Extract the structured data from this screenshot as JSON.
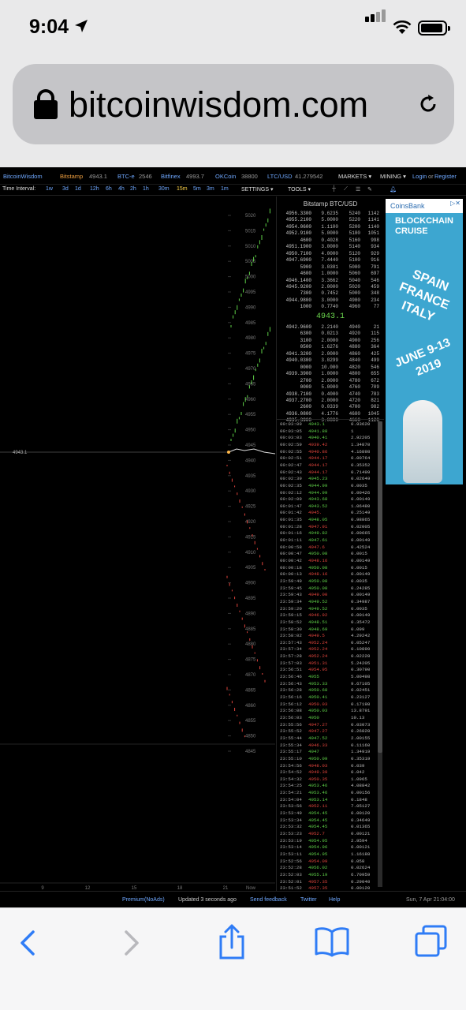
{
  "status_bar": {
    "time": "9:04"
  },
  "browser": {
    "url": "bitcoinwisdom.com"
  },
  "topnav": {
    "brand": "BitcoinWisdom",
    "exchanges": [
      {
        "name": "Bitstamp",
        "price": "4943.1"
      },
      {
        "name": "BTC-e",
        "price": "2546"
      },
      {
        "name": "Bitfinex",
        "price": "4993.7"
      },
      {
        "name": "OKCoin",
        "price": "38800"
      },
      {
        "name": "LTC/USD",
        "price": "41.279542"
      }
    ],
    "markets": "MARKETS ▾",
    "mining": "MINING ▾",
    "login": "Login",
    "or": "or",
    "register": "Register"
  },
  "toolbar": {
    "time_interval_label": "Time Interval:",
    "intervals": [
      "1w",
      "3d",
      "1d",
      "12h",
      "6h",
      "4h",
      "2h",
      "1h",
      "30m",
      "15m",
      "5m",
      "3m",
      "1m"
    ],
    "settings": "SETTINGS ▾",
    "tools": "TOOLS ▾"
  },
  "chart": {
    "price_label": "4943.1",
    "y_ticks": [
      "5020",
      "5015",
      "5010",
      "5005",
      "5000",
      "4995",
      "4990",
      "4985",
      "4980",
      "4975",
      "4970",
      "4965",
      "4960",
      "4955",
      "4950",
      "4945",
      "4940",
      "4935",
      "4930",
      "4925",
      "4920",
      "4915",
      "4910",
      "4905",
      "4900",
      "4895",
      "4890",
      "4885",
      "4880",
      "4875",
      "4870",
      "4865",
      "4860",
      "4855",
      "4850",
      "4845"
    ],
    "x_ticks": [
      "9",
      "12",
      "15",
      "18",
      "21",
      "Now"
    ]
  },
  "orderbook": {
    "title": "Bitstamp BTC/USD",
    "asks": [
      [
        "4956.3300",
        "9.6235",
        "5240",
        "1142"
      ],
      [
        "4955.2100",
        "5.0000",
        "5220",
        "1141"
      ],
      [
        "4954.0600",
        "1.1100",
        "5200",
        "1140"
      ],
      [
        "4952.9100",
        "5.0000",
        "5180",
        "1051"
      ],
      [
        "4600",
        "0.4028",
        "5160",
        "998"
      ],
      [
        "4951.1900",
        "3.0000",
        "5140",
        "934"
      ],
      [
        "4950.7100",
        "4.0000",
        "5120",
        "929"
      ],
      [
        "4947.6900",
        "7.4440",
        "5100",
        "916"
      ],
      [
        "5900",
        "3.0301",
        "5080",
        "791"
      ],
      [
        "4600",
        "1.0000",
        "5060",
        "697"
      ],
      [
        "4946.1400",
        "3.3662",
        "5040",
        "546"
      ],
      [
        "4945.9200",
        "2.0000",
        "5020",
        "459"
      ],
      [
        "7300",
        "0.7452",
        "5000",
        "348"
      ],
      [
        "4944.9800",
        "3.0000",
        "4980",
        "234"
      ],
      [
        "1000",
        "0.7740",
        "4960",
        "77"
      ]
    ],
    "last": "4943.1",
    "bids": [
      [
        "4942.9600",
        "2.2140",
        "4940",
        "21"
      ],
      [
        "6300",
        "0.0213",
        "4920",
        "115"
      ],
      [
        "3100",
        "2.0000",
        "4900",
        "256"
      ],
      [
        "0500",
        "1.6276",
        "4880",
        "364"
      ],
      [
        "4941.3200",
        "2.0000",
        "4860",
        "425"
      ],
      [
        "4940.0300",
        "3.0299",
        "4840",
        "499"
      ],
      [
        "0000",
        "10.000",
        "4820",
        "546"
      ],
      [
        "4939.3900",
        "1.0000",
        "4800",
        "655"
      ],
      [
        "2700",
        "2.0000",
        "4780",
        "672"
      ],
      [
        "0000",
        "5.0000",
        "4760",
        "709"
      ],
      [
        "4938.7100",
        "0.4000",
        "4740",
        "783"
      ],
      [
        "4937.2700",
        "2.0000",
        "4720",
        "821"
      ],
      [
        "2600",
        "0.0339",
        "4700",
        "982"
      ],
      [
        "4936.0800",
        "4.1776",
        "4680",
        "1045"
      ],
      [
        "4935.3900",
        "3.0000",
        "4660",
        "1128"
      ]
    ]
  },
  "trades": [
    [
      "00:03:09",
      "4943.1",
      "0.93620",
      "g"
    ],
    [
      "00:03:05",
      "4941.88",
      "1",
      "g"
    ],
    [
      "00:03:03",
      "4940.41",
      "2.92205",
      "g"
    ],
    [
      "00:02:59",
      "4939.42",
      "1.34870",
      "r"
    ],
    [
      "00:02:55",
      "4940.86",
      "4.16898",
      "r"
    ],
    [
      "00:02:51",
      "4944.17",
      "0.00764",
      "r"
    ],
    [
      "00:02:47",
      "4944.17",
      "0.35352",
      "r"
    ],
    [
      "00:02:43",
      "4944.17",
      "0.71499",
      "r"
    ],
    [
      "00:02:39",
      "4945.23",
      "0.02649",
      "g"
    ],
    [
      "00:02:35",
      "4944.99",
      "0.0035",
      "g"
    ],
    [
      "00:02:12",
      "4944.99",
      "0.00426",
      "g"
    ],
    [
      "00:02:09",
      "4943.68",
      "0.00149",
      "g"
    ],
    [
      "00:01:47",
      "4943.52",
      "1.06480",
      "g"
    ],
    [
      "00:01:42",
      "4945.",
      "0.25149",
      "r"
    ],
    [
      "00:01:35",
      "4948.05",
      "0.98865",
      "g"
    ],
    [
      "00:01:28",
      "4947.91",
      "0.02005",
      "r"
    ],
    [
      "00:01:16",
      "4949.82",
      "0.00665",
      "g"
    ],
    [
      "00:01:11",
      "4947.61",
      "0.00149",
      "g"
    ],
    [
      "00:00:58",
      "4947.6",
      "0.42524",
      "r"
    ],
    [
      "00:00:47",
      "4950.08",
      "0.0015",
      "g"
    ],
    [
      "00:00:42",
      "4948.16",
      "0.00149",
      "r"
    ],
    [
      "00:00:18",
      "4950.08",
      "0.0015",
      "g"
    ],
    [
      "00:00:13",
      "4948.16",
      "0.00149",
      "r"
    ],
    [
      "23:59:49",
      "4950.08",
      "0.0035",
      "g"
    ],
    [
      "23:59:45",
      "4950.08",
      "0.24285",
      "g"
    ],
    [
      "23:59:43",
      "4949.00",
      "0.00149",
      "r"
    ],
    [
      "23:59:34",
      "4949.52",
      "0.34987",
      "g"
    ],
    [
      "23:59:20",
      "4949.52",
      "0.0035",
      "g"
    ],
    [
      "23:59:15",
      "4946.92",
      "0.00149",
      "r"
    ],
    [
      "23:58:52",
      "4948.51",
      "0.35472",
      "g"
    ],
    [
      "23:58:30",
      "4948.69",
      "0.099",
      "g"
    ],
    [
      "23:58:02",
      "4949.5",
      "4.29242",
      "r"
    ],
    [
      "23:57:43",
      "4952.24",
      "0.05247",
      "r"
    ],
    [
      "23:57:34",
      "4952.24",
      "0.10890",
      "r"
    ],
    [
      "23:57:28",
      "4952.24",
      "0.02228",
      "r"
    ],
    [
      "23:57:03",
      "4951.31",
      "5.24205",
      "r"
    ],
    [
      "23:56:51",
      "4954.95",
      "0.30790",
      "r"
    ],
    [
      "23:56:46",
      "4955",
      "5.00498",
      "g"
    ],
    [
      "23:56:43",
      "4953.33",
      "9.67105",
      "g"
    ],
    [
      "23:56:28",
      "4950.68",
      "0.02451",
      "g"
    ],
    [
      "23:56:16",
      "4950.41",
      "0.23127",
      "g"
    ],
    [
      "23:56:12",
      "4950.03",
      "0.17198",
      "r"
    ],
    [
      "23:56:08",
      "4950.03",
      "13.8791",
      "g"
    ],
    [
      "23:56:03",
      "4950",
      "10.13",
      "g"
    ],
    [
      "23:55:56",
      "4947.27",
      "0.03073",
      "r"
    ],
    [
      "23:55:52",
      "4947.27",
      "0.26828",
      "r"
    ],
    [
      "23:55:44",
      "4947.52",
      "2.00155",
      "g"
    ],
    [
      "23:55:34",
      "4946.33",
      "0.11160",
      "r"
    ],
    [
      "23:55:17",
      "4947",
      "1.34919",
      "g"
    ],
    [
      "23:55:10",
      "4950.09",
      "0.35319",
      "g"
    ],
    [
      "23:54:56",
      "4948.03",
      "0.039",
      "r"
    ],
    [
      "23:54:52",
      "4949.39",
      "0.042",
      "r"
    ],
    [
      "23:54:32",
      "4950.35",
      "1.0965",
      "r"
    ],
    [
      "23:54:25",
      "4953.46",
      "4.08842",
      "g"
    ],
    [
      "23:54:21",
      "4953.46",
      "0.00156",
      "g"
    ],
    [
      "23:54:04",
      "4953.14",
      "0.1848",
      "g"
    ],
    [
      "23:53:56",
      "4952.11",
      "7.05127",
      "r"
    ],
    [
      "23:53:49",
      "4954.45",
      "0.00120",
      "g"
    ],
    [
      "23:53:34",
      "4954.45",
      "0.34649",
      "g"
    ],
    [
      "23:53:32",
      "4954.45",
      "0.01365",
      "g"
    ],
    [
      "23:53:23",
      "4952.7",
      "0.00121",
      "r"
    ],
    [
      "23:53:19",
      "4954.95",
      "2.9594",
      "g"
    ],
    [
      "23:53:14",
      "4954.96",
      "0.00121",
      "g"
    ],
    [
      "23:53:11",
      "4954.95",
      "1.16188",
      "g"
    ],
    [
      "23:52:56",
      "4954.09",
      "0.058",
      "r"
    ],
    [
      "23:52:28",
      "4956.02",
      "0.02624",
      "g"
    ],
    [
      "23:52:03",
      "4955.19",
      "6.70959",
      "g"
    ],
    [
      "23:52:01",
      "4957.35",
      "0.29040",
      "r"
    ],
    [
      "23:51:52",
      "4957.35",
      "0.00120",
      "r"
    ],
    [
      "23:51:35",
      "4958.41",
      "0.29145",
      "g"
    ],
    [
      "23:51:29",
      "4956.31",
      "0.03068",
      "r"
    ],
    [
      "23:50:58",
      "4957.33",
      "0.01",
      "g"
    ],
    [
      "23:50:38",
      "4956.02",
      "0.02095",
      "r"
    ],
    [
      "23:50:28",
      "4959.02",
      "0.16",
      "g"
    ],
    [
      "23:50:21",
      "4957.38",
      "0.00120",
      "r"
    ],
    [
      "23:50:17",
      "4958.12",
      "0.06246",
      "r"
    ],
    [
      "23:50:13",
      "4958.12",
      "0.00120",
      "r"
    ]
  ],
  "ad": {
    "brand": "CoinsBank",
    "headline": "BLOCKCHAIN CRUISE",
    "route": "SPAIN FRANCE ITALY",
    "dates": "JUNE 9-13 2019"
  },
  "footer": {
    "premium": "Premium(NoAds)",
    "updated": "Updated 3 seconds ago",
    "feedback": "Send feedback",
    "twitter": "Twitter",
    "help": "Help",
    "datetime": "Sun, 7 Apr 21:04:00"
  },
  "colors": {
    "up": "#5fd048",
    "down": "#e0443c",
    "link": "#6fa8ff",
    "ios_blue": "#2f7cf6"
  }
}
